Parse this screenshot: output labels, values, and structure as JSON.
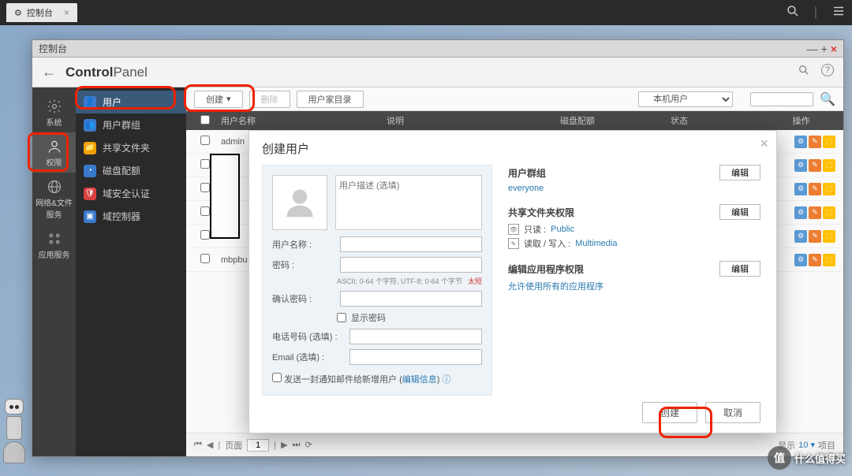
{
  "topbar": {
    "tab_label": "控制台"
  },
  "window": {
    "title": "控制台"
  },
  "header": {
    "logo_bold": "Control",
    "logo_light": "Panel"
  },
  "leftnav": [
    {
      "label": "系统"
    },
    {
      "label": "权限"
    },
    {
      "label": "网络&文件服务"
    },
    {
      "label": "应用服务"
    }
  ],
  "subnav": [
    {
      "label": "用户",
      "color": "#3a7acc"
    },
    {
      "label": "用户群组",
      "color": "#3a7acc"
    },
    {
      "label": "共享文件夹",
      "color": "#f2a000"
    },
    {
      "label": "磁盘配额",
      "color": "#3a7acc"
    },
    {
      "label": "域安全认证",
      "color": "#d94040"
    },
    {
      "label": "域控制器",
      "color": "#3a7acc"
    }
  ],
  "toolbar": {
    "create": "创建",
    "delete": "删除",
    "home": "用户家目录",
    "local_user": "本机用户"
  },
  "table": {
    "headers": {
      "name": "用户名称",
      "desc": "说明",
      "quota": "磁盘配额",
      "status": "状态",
      "ops": "操作"
    },
    "rows": [
      {
        "name": "admin"
      },
      {
        "name": ""
      },
      {
        "name": ""
      },
      {
        "name": ""
      },
      {
        "name": ""
      },
      {
        "name": "mbpbu"
      }
    ]
  },
  "pagination": {
    "page_label": "页面",
    "page": "1",
    "display_label": "显示",
    "display_count": "10",
    "items_label": "项目"
  },
  "modal": {
    "title": "创建用户",
    "desc_placeholder": "用户描述 (选填)",
    "username_label": "用户名称 :",
    "password_label": "密码 :",
    "password_hint": "ASCII; 0-64 个字符, UTF-8; 0-64 个字节",
    "too_short": "太短",
    "confirm_label": "确认密码 :",
    "show_pwd": "显示密码",
    "phone_label": "电话号码 (选填) :",
    "email_label": "Email (选填) :",
    "notify_label": "发送一封通知邮件给新增用户 (",
    "notify_link": "编辑信息",
    "notify_close": ")",
    "groups_title": "用户群组",
    "groups_value": "everyone",
    "shares_title": "共享文件夹权限",
    "readonly_label": "只读 :",
    "readonly_value": "Public",
    "readwrite_label": "读取 / 写入 :",
    "readwrite_value": "Multimedia",
    "app_title": "编辑应用程序权限",
    "app_allow": "允许使用所有的应用程序",
    "edit_btn": "编辑",
    "create_btn": "创建",
    "cancel_btn": "取消"
  },
  "watermark": {
    "symbol": "值",
    "text": "什么值得买"
  }
}
